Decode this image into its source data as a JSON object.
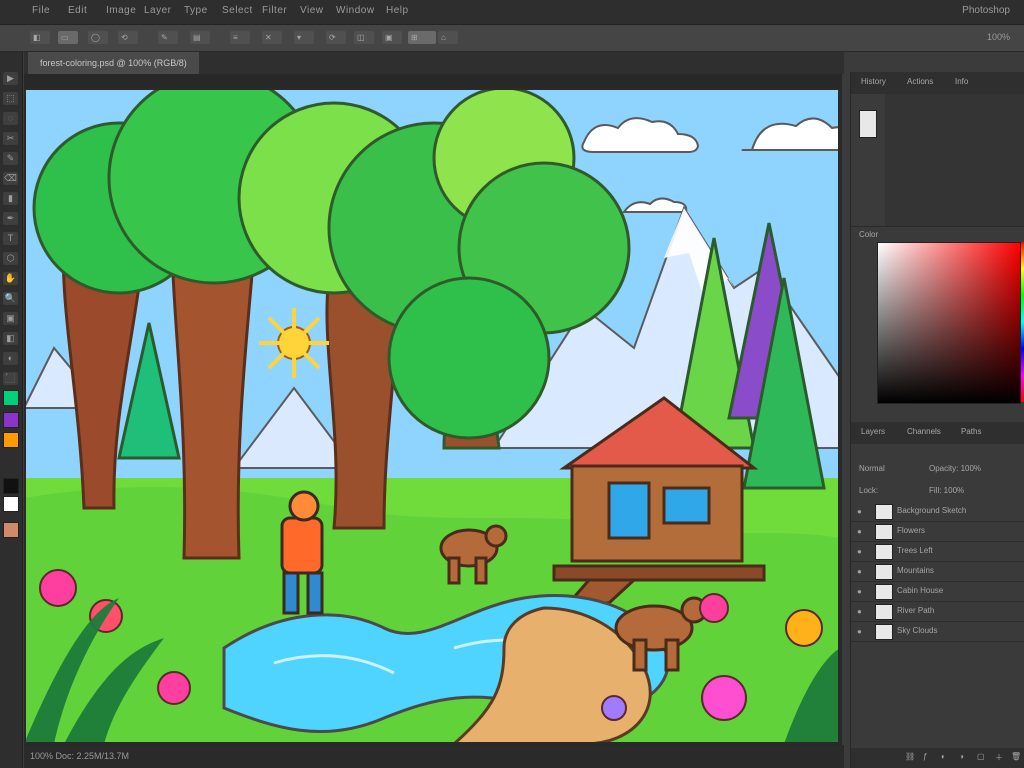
{
  "app": {
    "menu": [
      "File",
      "Edit",
      "Image",
      "Layer",
      "Type",
      "Select",
      "Filter",
      "View",
      "Window",
      "Help"
    ],
    "menu_right": "Photoshop",
    "doc_tab": "forest-coloring.psd @ 100% (RGB/8)",
    "zoom": "100%",
    "status": "100%   Doc: 2.25M/13.7M"
  },
  "options_bar": {
    "items": [
      "◧",
      "▭",
      "◯",
      "⟲",
      "✎",
      "▤",
      "≡",
      "✕",
      "▾",
      "⟳",
      "◫",
      "▣",
      "⊞",
      "⌂"
    ]
  },
  "tools": {
    "items": [
      "▶",
      "⬚",
      "◌",
      "✂",
      "✎",
      "⌫",
      "▮",
      "✒",
      "T",
      "⬡",
      "✋",
      "🔍",
      "▣",
      "◧",
      "◐",
      "⬛",
      "⊕",
      "⊘",
      "⋯",
      "↺",
      "◍",
      "▧",
      "⋮"
    ]
  },
  "panels": {
    "top_tabs": [
      "History",
      "Actions",
      "Info"
    ],
    "color_title": "Color",
    "adjust_tabs": [
      "Layers",
      "Channels",
      "Paths"
    ],
    "blend_mode": "Normal",
    "opacity_label": "Opacity: 100%",
    "lock_label": "Lock:",
    "fill_label": "Fill: 100%",
    "layers": [
      {
        "name": "Background Sketch"
      },
      {
        "name": "Flowers"
      },
      {
        "name": "Trees Left"
      },
      {
        "name": "Mountains"
      },
      {
        "name": "Cabin House"
      },
      {
        "name": "River Path"
      },
      {
        "name": "Sky Clouds"
      }
    ]
  },
  "colors": {
    "menubar": "#2e2e2e",
    "panel": "#3a3a3a",
    "foreground": "#111111",
    "background": "#ffffff"
  }
}
